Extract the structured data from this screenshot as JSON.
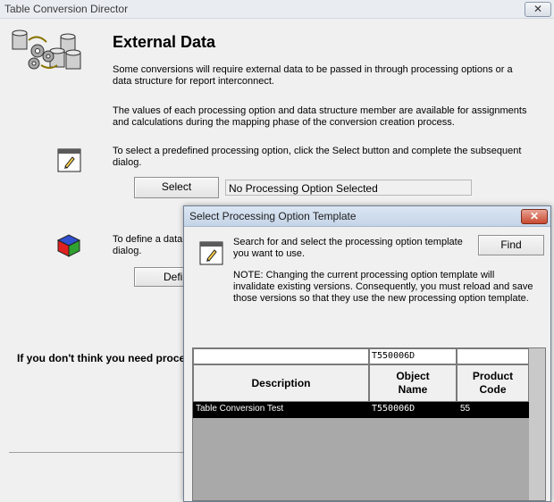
{
  "main": {
    "title": "Table Conversion Director",
    "close_label": "✕",
    "heading": "External Data",
    "para1": "Some conversions will require external data to be passed in through processing options or a data structure for report interconnect.",
    "para2": "The values of each processing option and data structure member are available for assignments and calculations during the mapping phase of the conversion creation process.",
    "para3": "To select a predefined processing option, click the Select button and complete the subsequent dialog.",
    "select_label": "Select",
    "status_text": "No Processing Option Selected",
    "para4_line1": "To define a data",
    "para4_line2": "dialog.",
    "define_label": "Defi",
    "bottom_text": "If you don't think you need proce"
  },
  "dialog": {
    "title": "Select Processing Option Template",
    "close_label": "✕",
    "instruction": "Search for and select the processing option template you want to use.",
    "find_label": "Find",
    "note": "NOTE: Changing the current processing option template will invalidate existing versions. Consequently, you must reload and save those versions so that they use the new processing option template.",
    "grid": {
      "filter_object_name": "T550006D",
      "columns": [
        "Description",
        "Object Name",
        "Product Code"
      ],
      "rows": [
        {
          "description": "Table Conversion Test",
          "object_name": "T550006D",
          "product_code": "55"
        }
      ]
    }
  },
  "colors": {
    "selected_row_bg": "#000000",
    "selected_row_fg": "#ffffff",
    "grid_empty_bg": "#a9a9a9"
  },
  "icons": [
    "database-conversion-icon",
    "edit-form-icon",
    "data-structure-cube-icon",
    "close-icon"
  ]
}
